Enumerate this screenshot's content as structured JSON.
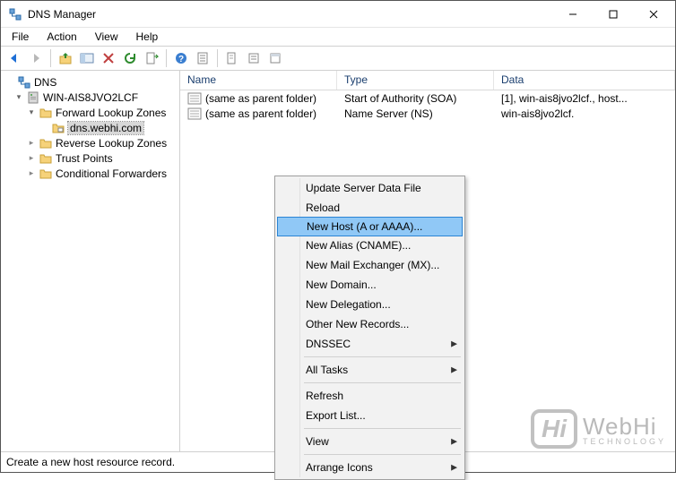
{
  "window": {
    "title": "DNS Manager"
  },
  "menubar": {
    "items": [
      {
        "label": "File"
      },
      {
        "label": "Action"
      },
      {
        "label": "View"
      },
      {
        "label": "Help"
      }
    ]
  },
  "tree": {
    "root": {
      "label": "DNS"
    },
    "server": {
      "label": "WIN-AIS8JVO2LCF"
    },
    "flz": {
      "label": "Forward Lookup Zones"
    },
    "zone": {
      "label": "dns.webhi.com"
    },
    "rlz": {
      "label": "Reverse Lookup Zones"
    },
    "tp": {
      "label": "Trust Points"
    },
    "cf": {
      "label": "Conditional Forwarders"
    }
  },
  "list": {
    "headers": {
      "name": "Name",
      "type": "Type",
      "data": "Data"
    },
    "rows": [
      {
        "name": "(same as parent folder)",
        "type": "Start of Authority (SOA)",
        "data": "[1], win-ais8jvo2lcf., host..."
      },
      {
        "name": "(same as parent folder)",
        "type": "Name Server (NS)",
        "data": "win-ais8jvo2lcf."
      }
    ]
  },
  "context_menu": {
    "items": [
      {
        "label": "Update Server Data File"
      },
      {
        "label": "Reload"
      },
      {
        "label": "New Host (A or AAAA)...",
        "highlighted": true
      },
      {
        "label": "New Alias (CNAME)..."
      },
      {
        "label": "New Mail Exchanger (MX)..."
      },
      {
        "label": "New Domain..."
      },
      {
        "label": "New Delegation..."
      },
      {
        "label": "Other New Records..."
      },
      {
        "label": "DNSSEC",
        "submenu": true
      },
      {
        "sep": true
      },
      {
        "label": "All Tasks",
        "submenu": true
      },
      {
        "sep": true
      },
      {
        "label": "Refresh"
      },
      {
        "label": "Export List..."
      },
      {
        "sep": true
      },
      {
        "label": "View",
        "submenu": true
      },
      {
        "sep": true
      },
      {
        "label": "Arrange Icons",
        "submenu": true
      }
    ]
  },
  "statusbar": {
    "text": "Create a new host resource record."
  },
  "watermark": {
    "big": "WebHi",
    "small": "TECHNOLOGY",
    "badge": "Hi"
  }
}
